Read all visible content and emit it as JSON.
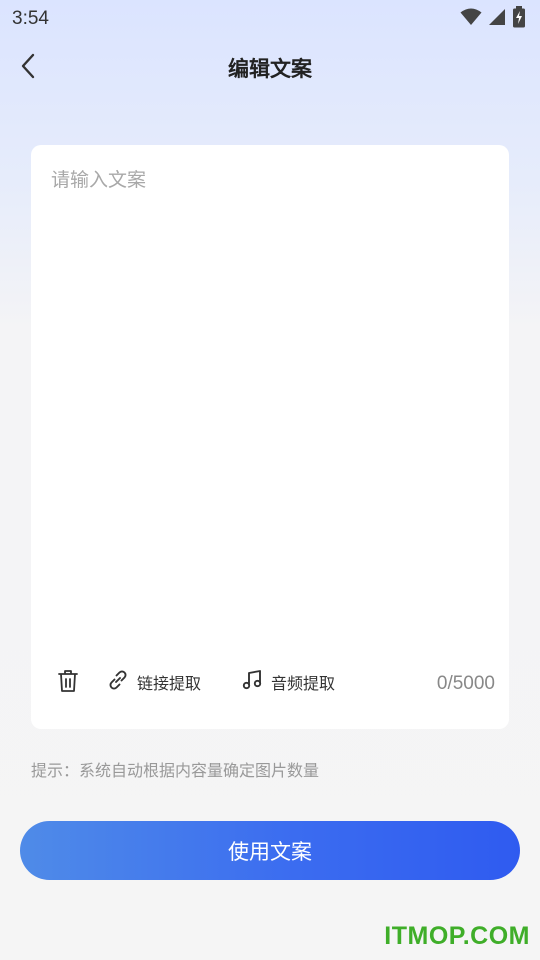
{
  "status_bar": {
    "time": "3:54",
    "icons": [
      "wifi-icon",
      "cellular-signal-icon",
      "battery-charging-icon"
    ]
  },
  "nav": {
    "back_icon": "chevron-left-icon",
    "title": "编辑文案"
  },
  "editor": {
    "value": "",
    "placeholder": "请输入文案",
    "toolbar": {
      "delete_icon": "trash-icon",
      "link_icon": "link-icon",
      "link_label": "链接提取",
      "audio_icon": "music-note-icon",
      "audio_label": "音频提取"
    },
    "char_count": "0/5000"
  },
  "hint": "提示：系统自动根据内容量确定图片数量",
  "use_button_label": "使用文案",
  "watermark": "ITMOP.COM",
  "colors": {
    "accent_start": "#4f8be8",
    "accent_end": "#2f5bf0",
    "watermark": "#3fae29"
  }
}
